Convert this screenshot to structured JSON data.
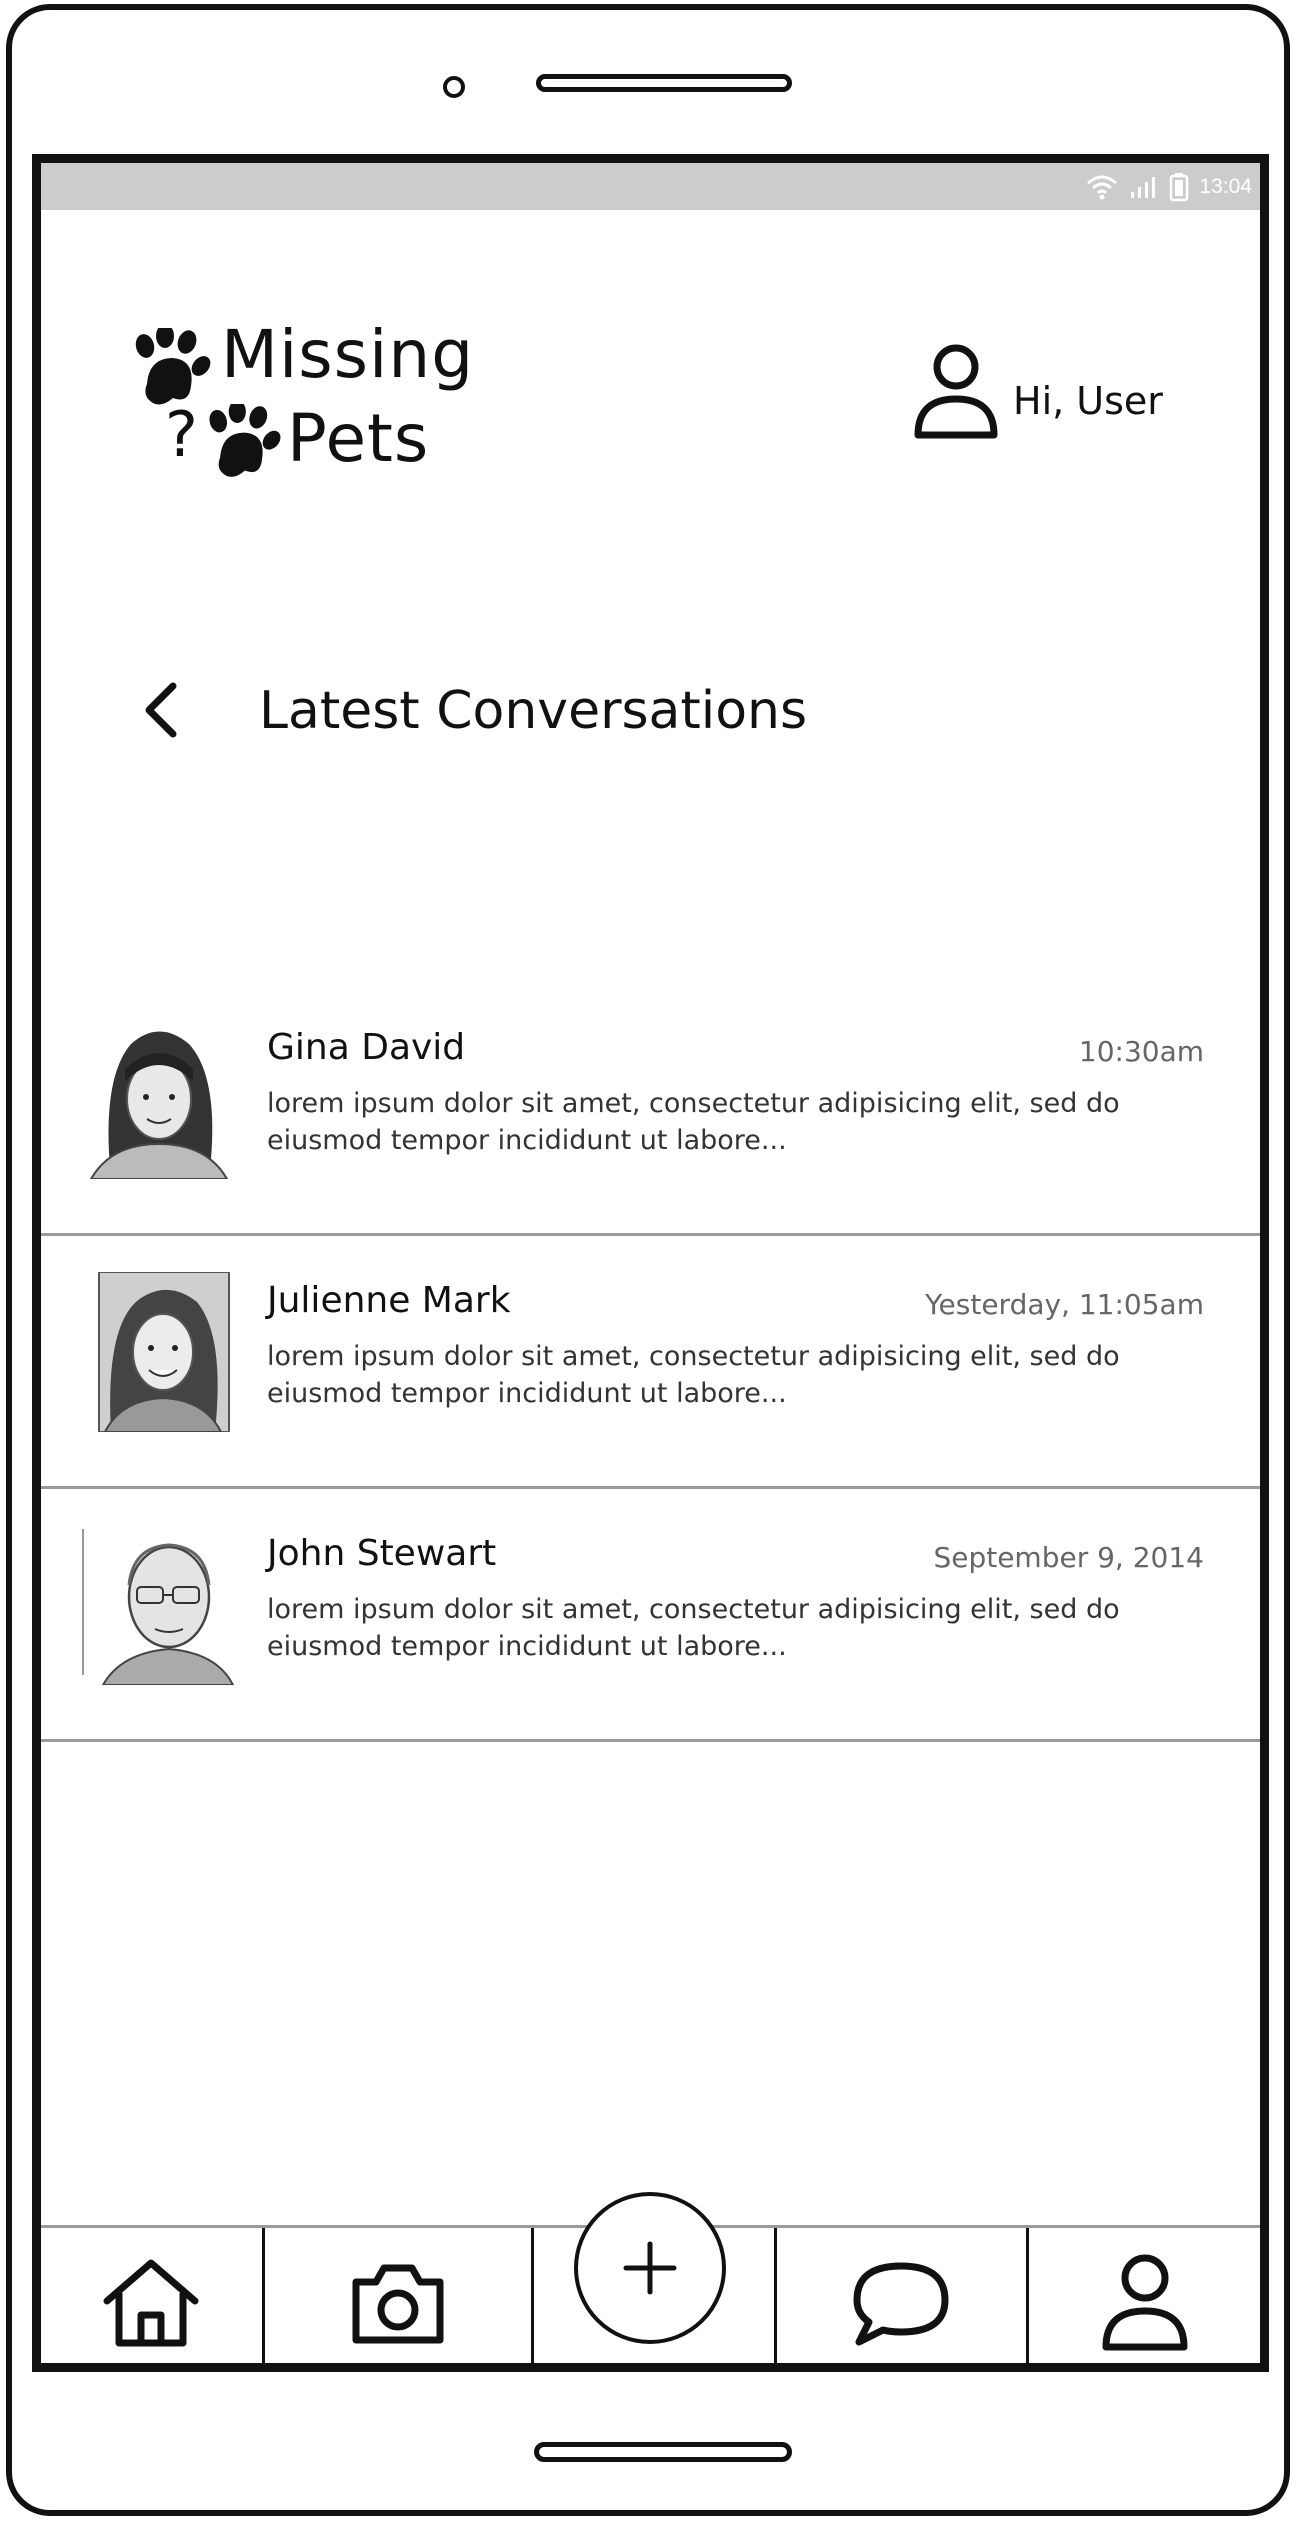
{
  "status_bar": {
    "time": "13:04",
    "icons": [
      "wifi-icon",
      "signal-icon",
      "battery-icon"
    ]
  },
  "header": {
    "logo": {
      "line1": "Missing",
      "line2": "Pets",
      "mark": "?"
    },
    "greeting": "Hi, User"
  },
  "page": {
    "title": "Latest Conversations"
  },
  "conversations": [
    {
      "name": "Gina David",
      "time": "10:30am",
      "preview": "lorem ipsum dolor sit amet, consectetur adipisicing elit, sed do eiusmod tempor incididunt ut labore..."
    },
    {
      "name": "Julienne Mark",
      "time": "Yesterday, 11:05am",
      "preview": "lorem ipsum dolor sit amet, consectetur adipisicing elit, sed do eiusmod tempor incididunt ut labore..."
    },
    {
      "name": "John Stewart",
      "time": "September 9, 2014",
      "preview": "lorem ipsum dolor sit amet, consectetur adipisicing elit, sed do eiusmod tempor incididunt ut labore..."
    }
  ],
  "bottom_nav": [
    "home-icon",
    "camera-icon",
    "plus-icon",
    "chat-icon",
    "user-icon"
  ]
}
